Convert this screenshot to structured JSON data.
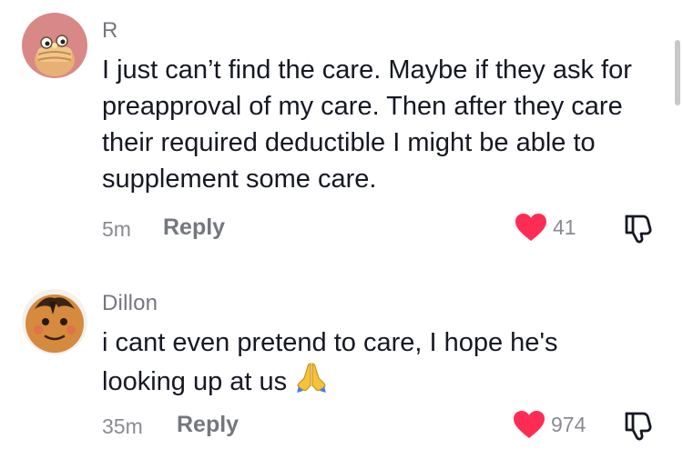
{
  "comments": [
    {
      "username": "R",
      "text": "I just can’t find the care. Maybe if they ask for preapproval of my care. Then after they care their required deductible I might be able to supplement some care.",
      "time": "5m",
      "reply_label": "Reply",
      "likes": "41"
    },
    {
      "username": "Dillon",
      "text": "i cant even pretend to care, I hope he's looking up at us",
      "emoji_icon": "folded-hands-icon",
      "time": "35m",
      "reply_label": "Reply",
      "likes": "974"
    }
  ],
  "colors": {
    "like_heart": "#fe2c55",
    "username": "#75777f",
    "meta": "#8a8b91",
    "text": "#161823"
  }
}
